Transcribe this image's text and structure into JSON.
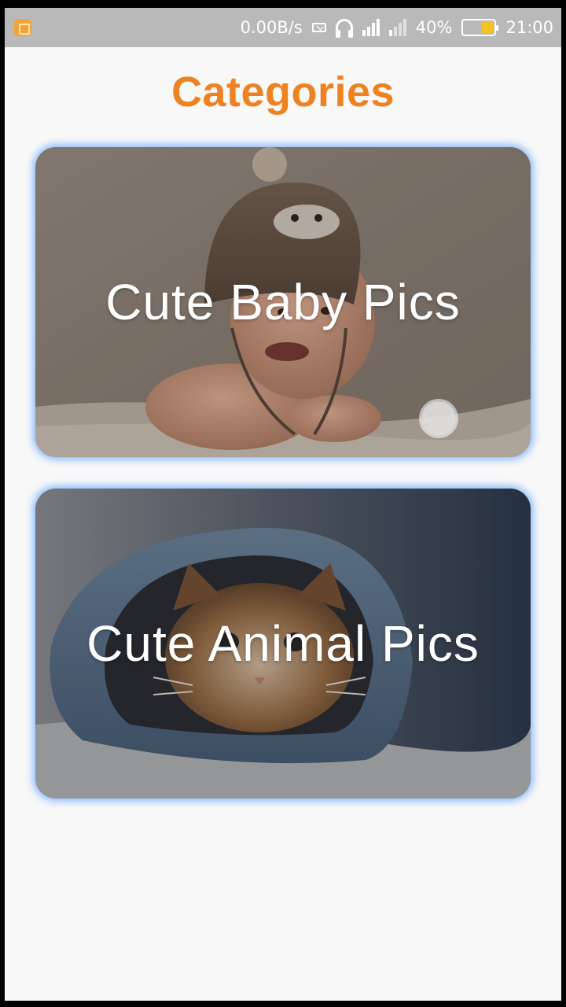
{
  "status_bar": {
    "network_speed": "0.00B/s",
    "battery_percent": "40%",
    "battery_level": 0.4,
    "time": "21:00",
    "icons": [
      "app-notification-icon",
      "mail-icon",
      "headset-icon",
      "signal-4g-icon",
      "signal-icon",
      "battery-icon"
    ]
  },
  "header": {
    "title": "Categories"
  },
  "categories": [
    {
      "label": "Cute Baby Pics"
    },
    {
      "label": "Cute Animal Pics"
    }
  ],
  "colors": {
    "title": "#ee8220",
    "card_glow": "#6eaaff",
    "status_bar": "#b9b9b9"
  }
}
